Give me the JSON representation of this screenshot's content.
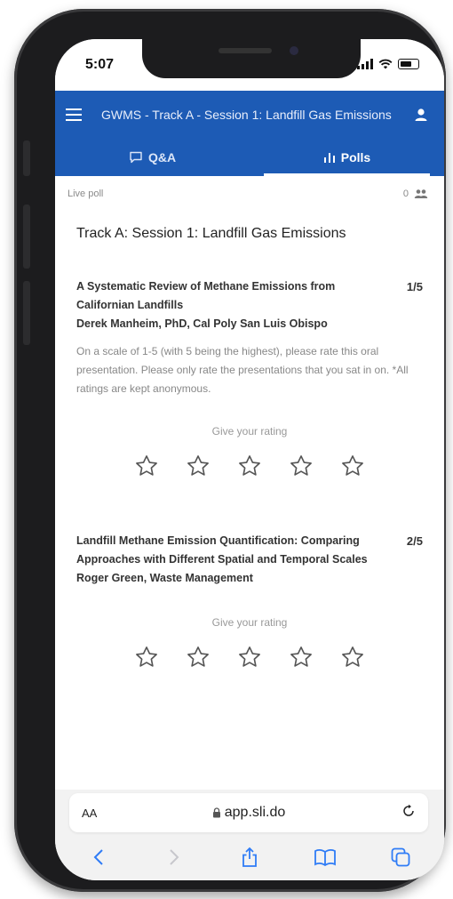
{
  "status_bar": {
    "time": "5:07"
  },
  "header": {
    "title": "GWMS - Track A - Session 1: Landfill Gas Emissions",
    "tabs": [
      {
        "label": "Q&A",
        "icon": "chat-bubble-icon",
        "active": false
      },
      {
        "label": "Polls",
        "icon": "bar-chart-icon",
        "active": true
      }
    ],
    "accent_color": "#1d5bb5"
  },
  "live_poll": {
    "label": "Live poll",
    "participants": "0"
  },
  "session_title": "Track A: Session 1: Landfill Gas Emissions",
  "polls": [
    {
      "title": "A Systematic Review of Methane Emissions from Californian Landfills",
      "speaker": "Derek Manheim, PhD, Cal Poly San Luis Obispo",
      "number": "1/5",
      "description": "On a scale of 1-5 (with 5 being the highest), please rate this oral presentation. Please only rate the presentations that you sat in on. *All ratings are kept anonymous.",
      "rating_label": "Give your rating",
      "stars": 5,
      "selected_rating": 0
    },
    {
      "title": "Landfill Methane Emission Quantification: Comparing Approaches with Different Spatial and Temporal Scales",
      "speaker": "Roger Green, Waste Management",
      "number": "2/5",
      "rating_label": "Give your rating",
      "stars": 5,
      "selected_rating": 0
    }
  ],
  "browser": {
    "text_size_label": "AA",
    "url": "app.sli.do",
    "toolbar": [
      "back-icon",
      "forward-icon",
      "share-icon",
      "bookmarks-icon",
      "tabs-icon"
    ]
  }
}
